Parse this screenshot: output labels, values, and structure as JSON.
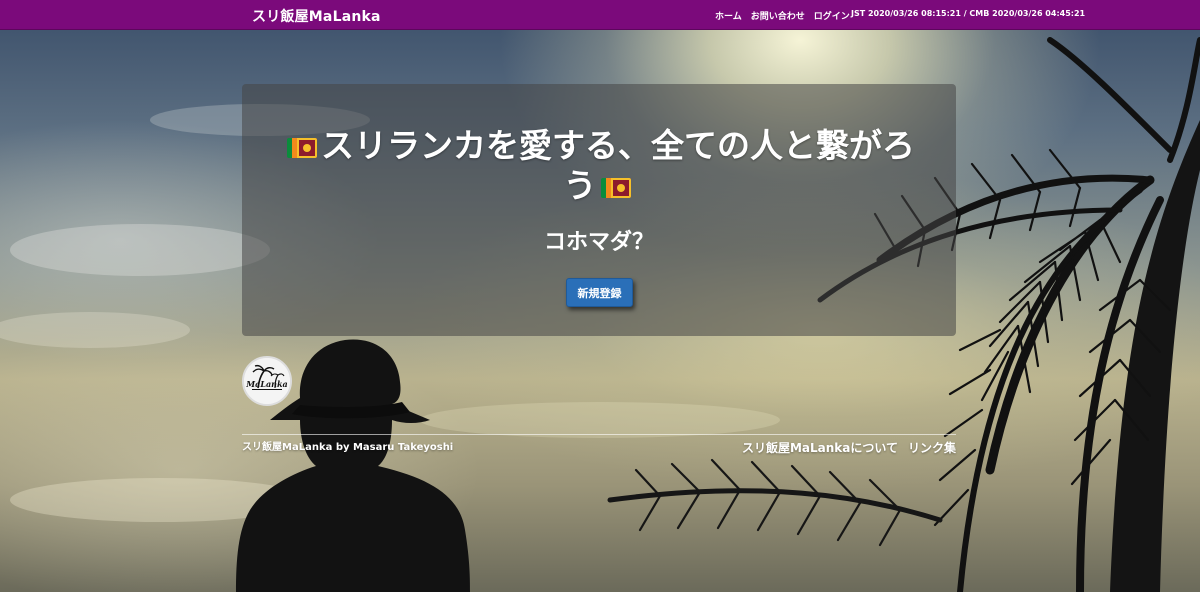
{
  "navbar": {
    "brand": "スリ飯屋MaLanka",
    "links": [
      "ホーム",
      "お問い合わせ",
      "ログイン"
    ],
    "clock": "JST 2020/03/26 08:15:21 / CMB 2020/03/26 04:45:21",
    "color": "#7b0a7b"
  },
  "hero": {
    "title": "スリランカを愛する、全ての人と繋がろう",
    "subtitle": "コホマダ？",
    "signup_label": "新規登録",
    "flag_icon": "sri-lanka-flag-icon"
  },
  "footer": {
    "logo_text": "MaLanka",
    "credit": "スリ飯屋MaLanka by Masaru Takeyoshi",
    "links": [
      "スリ飯屋MaLankaについて",
      "リンク集"
    ]
  },
  "colors": {
    "button": "#2a6fb8"
  }
}
